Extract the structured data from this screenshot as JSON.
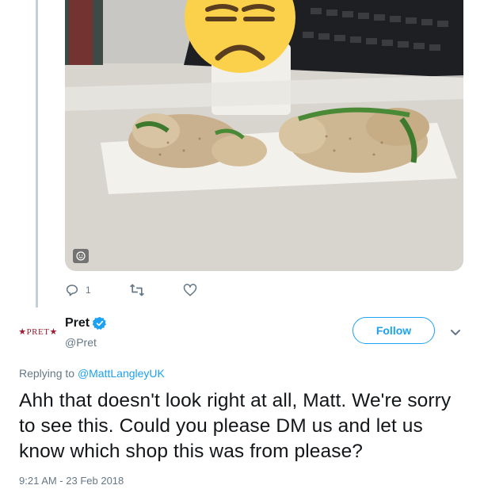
{
  "media": {
    "description_icon": "smiley-icon"
  },
  "actions": {
    "reply_count": "1",
    "reply_icon": "reply-icon",
    "retweet_icon": "retweet-icon",
    "like_icon": "heart-icon"
  },
  "tweet": {
    "avatar_text": "★PRET★",
    "display_name": "Pret",
    "handle": "@Pret",
    "follow_label": "Follow",
    "replying_prefix": "Replying to ",
    "replying_to": "@MattLangleyUK",
    "text": "Ahh that doesn't look right at all, Matt. We're sorry to see this. Could you please DM us and let us know which shop this was from please?",
    "timestamp": "9:21 AM - 23 Feb 2018"
  },
  "colors": {
    "accent": "#1da1f2",
    "muted": "#657786",
    "brand": "#9c1b2e"
  }
}
